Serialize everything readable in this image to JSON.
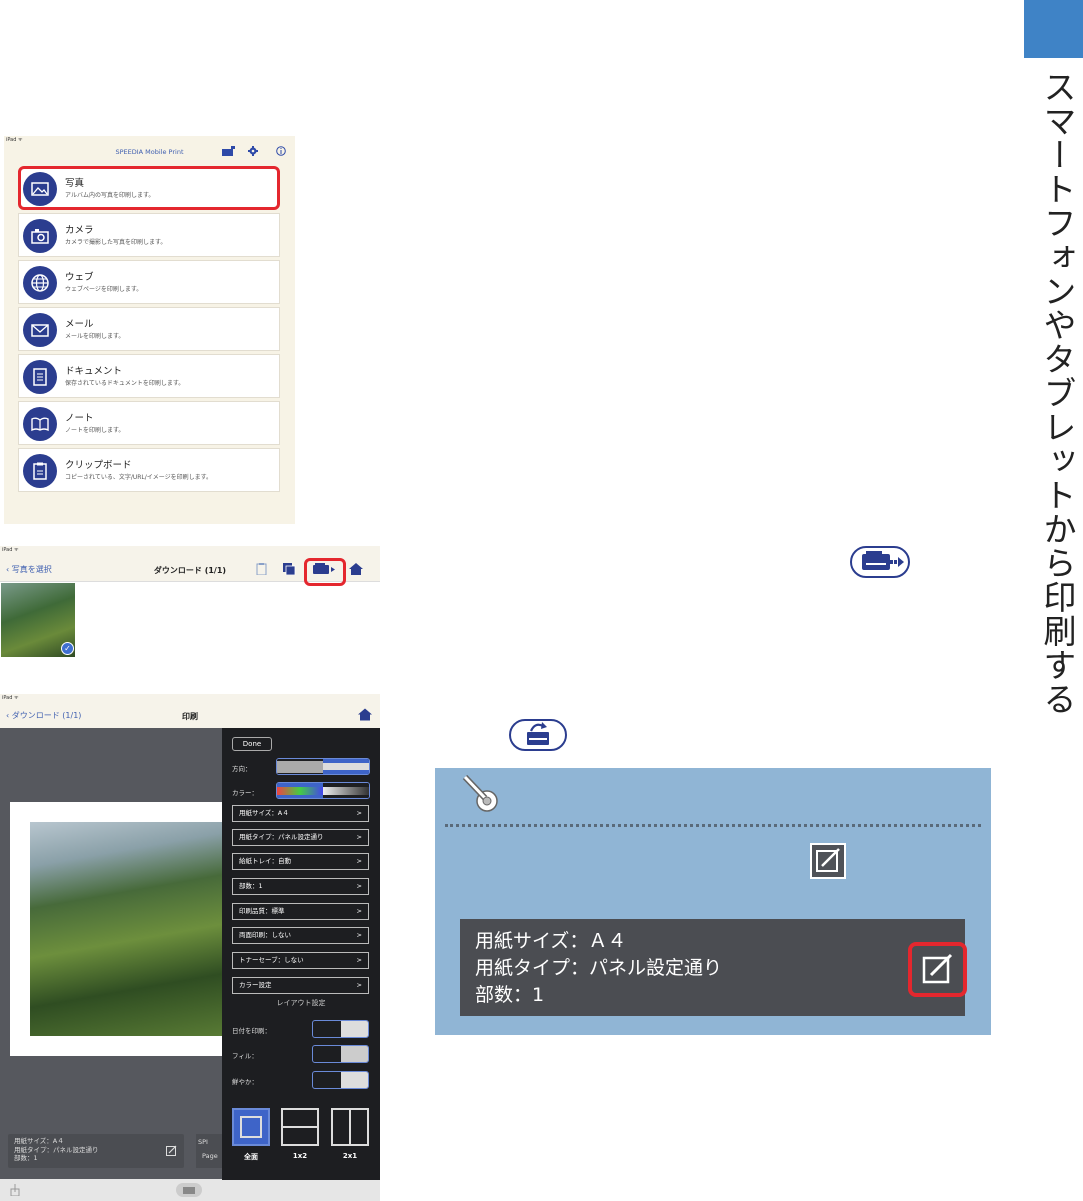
{
  "side_title": "スマートフォンやタブレットから印刷する",
  "screen1": {
    "status": "iPad ᯤ",
    "title": "SPEEDIA Mobile Print",
    "items": [
      {
        "title": "写真",
        "desc": "アルバム内の写真を印刷します。",
        "icon": "photo-icon"
      },
      {
        "title": "カメラ",
        "desc": "カメラで撮影した写真を印刷します。",
        "icon": "camera-icon"
      },
      {
        "title": "ウェブ",
        "desc": "ウェブページを印刷します。",
        "icon": "globe-icon"
      },
      {
        "title": "メール",
        "desc": "メールを印刷します。",
        "icon": "mail-icon"
      },
      {
        "title": "ドキュメント",
        "desc": "保存されているドキュメントを印刷します。",
        "icon": "document-icon"
      },
      {
        "title": "ノート",
        "desc": "ノートを印刷します。",
        "icon": "notebook-icon"
      },
      {
        "title": "クリップボード",
        "desc": "コピーされている、文字/URL/イメージを印刷します。",
        "icon": "clipboard-icon"
      }
    ]
  },
  "screen2": {
    "status": "iPad ᯤ",
    "back": "写真を選択",
    "title": "ダウンロード (1/1)",
    "check": "✓"
  },
  "screen3": {
    "status": "iPad ᯤ",
    "back": "ダウンロード (1/1)",
    "title": "印刷",
    "done": "Done",
    "direction_label": "方向：",
    "color_label": "カラー：",
    "rows": [
      "用紙サイズ：A４",
      "用紙タイプ：パネル設定通り",
      "給紙トレイ：自動",
      "部数：1",
      "印刷品質：標準",
      "両面印刷：しない",
      "トナーセーブ：しない",
      "カラー設定"
    ],
    "row_arrow": ">",
    "layout_heading": "レイアウト設定",
    "date_label": "日付を印刷：",
    "fill_label": "フィル：",
    "vivid_label": "鮮やか：",
    "layouts": [
      "全面",
      "1x2",
      "2x1"
    ],
    "info_lines": [
      "用紙サイズ：A４",
      "用紙タイプ：パネル設定通り",
      "部数：1"
    ],
    "printer_stub": "SPI",
    "page_stub": "Page"
  },
  "memo": {
    "lines": [
      "用紙サイズ：Ａ４",
      "用紙タイプ：パネル設定通り",
      "部数：1"
    ]
  },
  "colors": {
    "accent_blue": "#3f83c6",
    "icon_navy": "#2b3d8f",
    "highlight_red": "#e4272e",
    "memo_bg": "#90b5d5"
  }
}
